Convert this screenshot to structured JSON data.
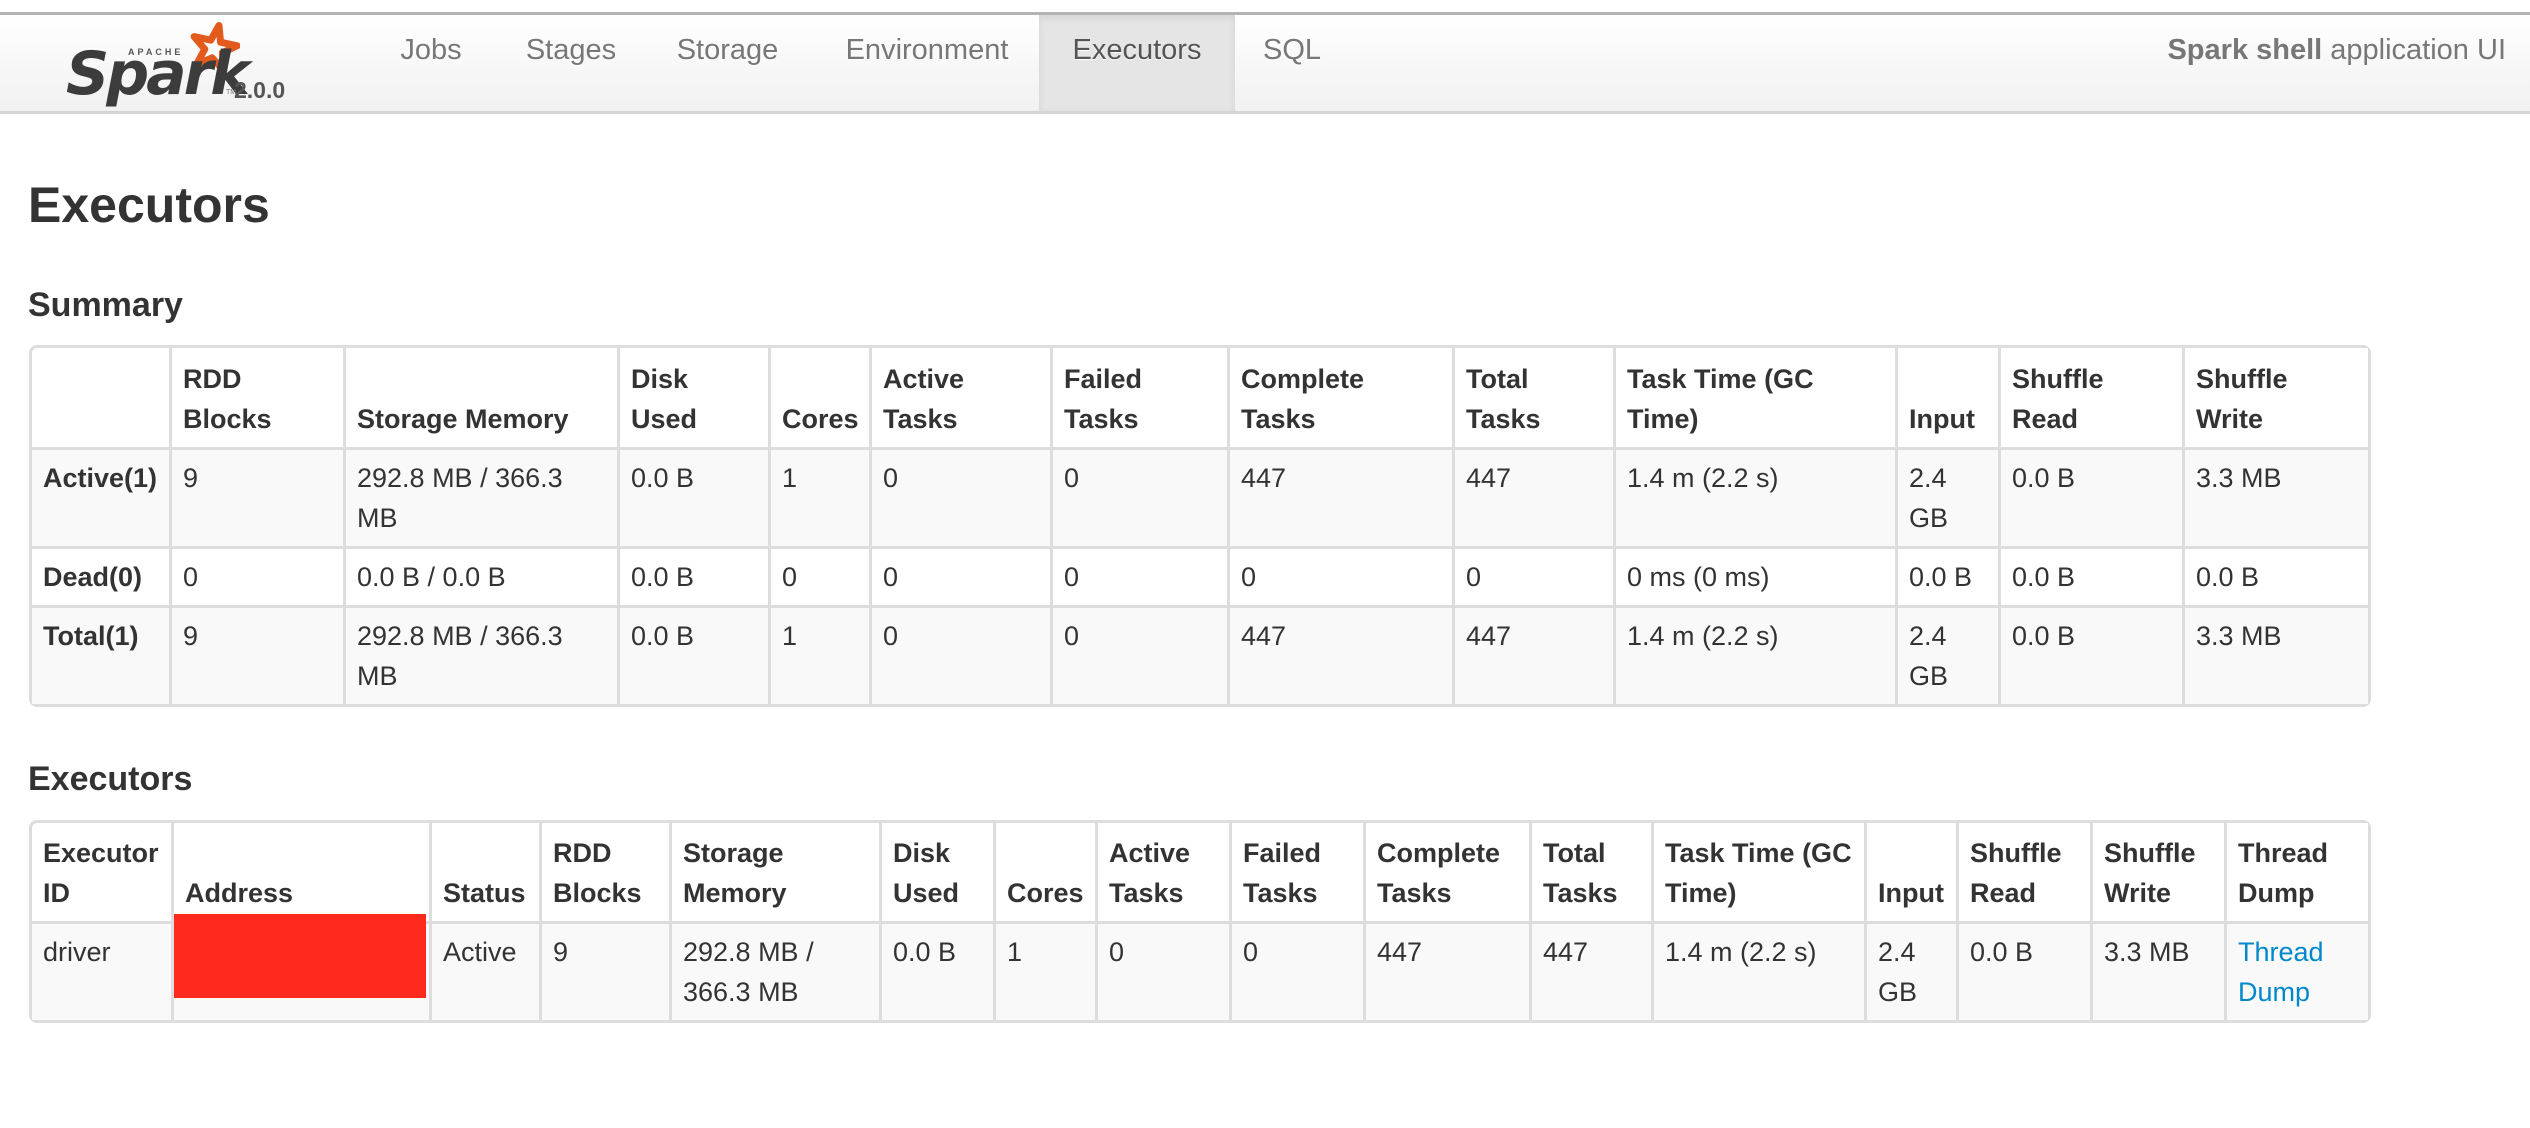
{
  "navbar": {
    "brand": {
      "apache": "APACHE",
      "name": "Spark",
      "version": "2.0.0"
    },
    "tabs": [
      {
        "label": "Jobs",
        "active": false
      },
      {
        "label": "Stages",
        "active": false
      },
      {
        "label": "Storage",
        "active": false
      },
      {
        "label": "Environment",
        "active": false
      },
      {
        "label": "Executors",
        "active": true
      },
      {
        "label": "SQL",
        "active": false
      }
    ],
    "app_name": "Spark shell",
    "app_suffix": "application UI"
  },
  "page_title": "Executors",
  "summary": {
    "title": "Summary",
    "columns": [
      "",
      "RDD Blocks",
      "Storage Memory",
      "Disk Used",
      "Cores",
      "Active Tasks",
      "Failed Tasks",
      "Complete Tasks",
      "Total Tasks",
      "Task Time (GC Time)",
      "Input",
      "Shuffle Read",
      "Shuffle Write"
    ],
    "rows": [
      [
        "Active(1)",
        "9",
        "292.8 MB / 366.3 MB",
        "0.0 B",
        "1",
        "0",
        "0",
        "447",
        "447",
        "1.4 m (2.2 s)",
        "2.4 GB",
        "0.0 B",
        "3.3 MB"
      ],
      [
        "Dead(0)",
        "0",
        "0.0 B / 0.0 B",
        "0.0 B",
        "0",
        "0",
        "0",
        "0",
        "0",
        "0 ms (0 ms)",
        "0.0 B",
        "0.0 B",
        "0.0 B"
      ],
      [
        "Total(1)",
        "9",
        "292.8 MB / 366.3 MB",
        "0.0 B",
        "1",
        "0",
        "0",
        "447",
        "447",
        "1.4 m (2.2 s)",
        "2.4 GB",
        "0.0 B",
        "3.3 MB"
      ]
    ]
  },
  "executors": {
    "title": "Executors",
    "columns": [
      "Executor ID",
      "Address",
      "Status",
      "RDD Blocks",
      "Storage Memory",
      "Disk Used",
      "Cores",
      "Active Tasks",
      "Failed Tasks",
      "Complete Tasks",
      "Total Tasks",
      "Task Time (GC Time)",
      "Input",
      "Shuffle Read",
      "Shuffle Write",
      "Thread Dump"
    ],
    "rows": [
      {
        "id": "driver",
        "address": "",
        "address_redacted": true,
        "status": "Active",
        "rdd_blocks": "9",
        "storage_memory": "292.8 MB / 366.3 MB",
        "disk_used": "0.0 B",
        "cores": "1",
        "active_tasks": "0",
        "failed_tasks": "0",
        "complete_tasks": "447",
        "total_tasks": "447",
        "task_time": "1.4 m (2.2 s)",
        "input": "2.4 GB",
        "shuffle_read": "0.0 B",
        "shuffle_write": "3.3 MB",
        "thread_dump": "Thread Dump"
      }
    ]
  },
  "colors": {
    "logo_orange": "#e25a1c",
    "link": "#0088cc",
    "redaction": "#fe2a1e"
  }
}
